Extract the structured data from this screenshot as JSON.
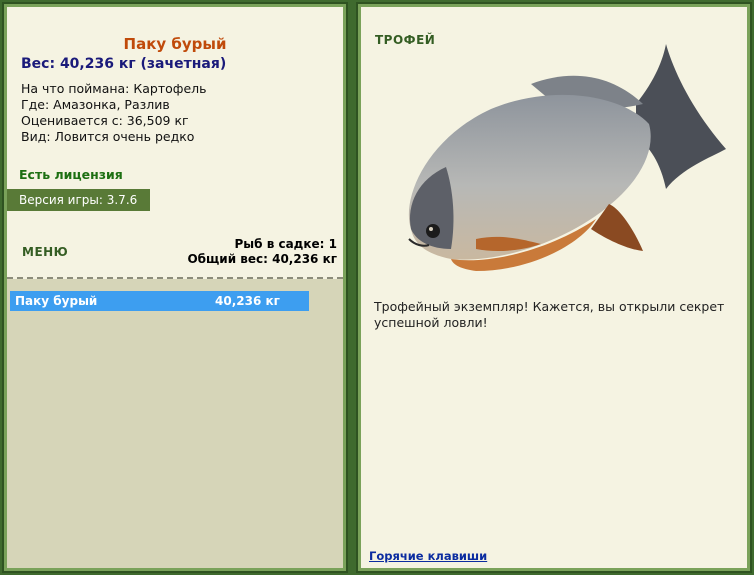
{
  "left": {
    "fish_name": "Паку бурый",
    "weight": "Вес: 40,236 кг (зачетная)",
    "caught_with": "На что поймана: Картофель",
    "location": "Где: Амазонка, Разлив",
    "valued_from": "Оценивается с: 36,509 кг",
    "kind": "Вид: Ловится очень редко",
    "license": "Есть лицензия",
    "version_label": "Версия игры:",
    "version_value": "3.7.6",
    "menu_label": "МЕНЮ",
    "cage_count": "Рыб в садке: 1",
    "cage_total": "Общий вес: 40,236 кг",
    "list": [
      {
        "name": "Паку бурый",
        "weight": "40,236 кг"
      }
    ]
  },
  "right": {
    "trophy_label": "ТРОФЕЙ",
    "description": "Трофейный экземпляр! Кажется, вы открыли секрет успешной ловли!",
    "hotkeys_link": "Горячие клавиши"
  }
}
